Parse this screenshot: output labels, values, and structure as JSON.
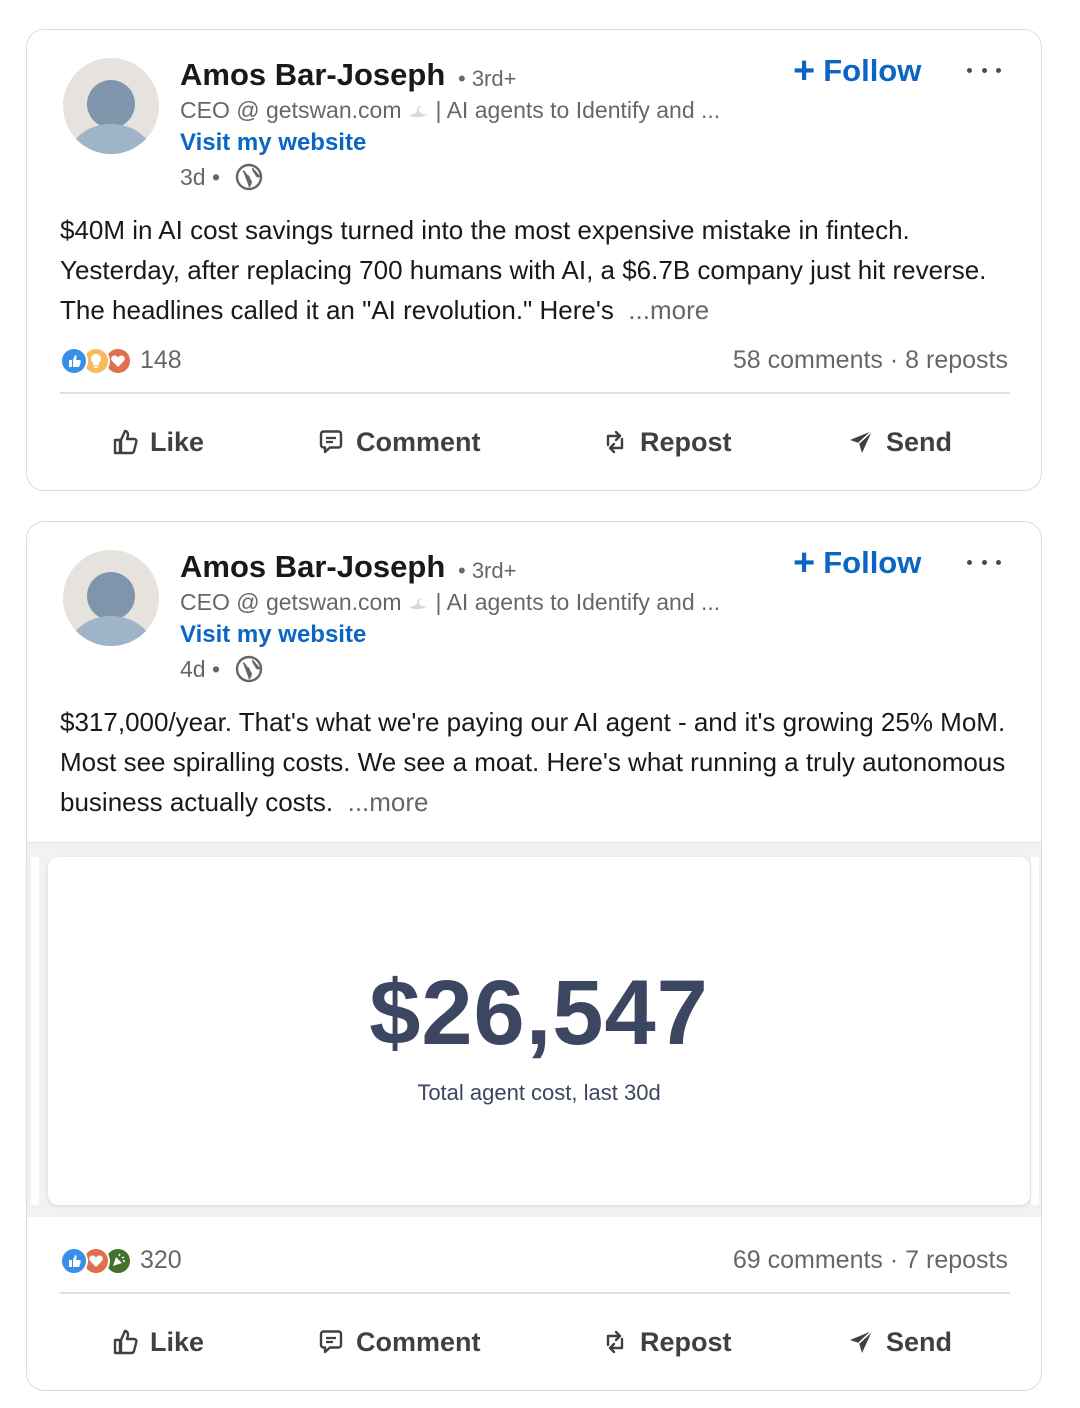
{
  "posts": [
    {
      "author": "Amos Bar-Joseph",
      "degree": "• 3rd+",
      "headline_pre": "CEO @ getswan.com",
      "headline_post": "| AI agents to Identify and ...",
      "website_link": "Visit my website",
      "time": "3d •",
      "follow_label": "Follow",
      "body": "$40M in AI cost savings turned into the most expensive mistake in fintech. Yesterday, after replacing 700 humans with AI, a $6.7B company just hit reverse. The headlines called it an \"AI revolution.\" Here's",
      "see_more": "...more",
      "reaction_icons": [
        "like-icon",
        "insightful-icon",
        "love-icon"
      ],
      "reaction_count": "148",
      "social_counts": "58 comments · 8 reposts",
      "actions": [
        "Like",
        "Comment",
        "Repost",
        "Send"
      ]
    },
    {
      "author": "Amos Bar-Joseph",
      "degree": "• 3rd+",
      "headline_pre": "CEO @ getswan.com",
      "headline_post": "| AI agents to Identify and ...",
      "website_link": "Visit my website",
      "time": "4d •",
      "follow_label": "Follow",
      "body": "$317,000/year. That's what we're paying our AI agent - and it's growing 25% MoM. Most see spiralling costs. We see a moat. Here's what running a truly autonomous business actually costs.",
      "see_more": "...more",
      "media": {
        "value": "$26,547",
        "label": "Total agent cost, last 30d"
      },
      "reaction_icons": [
        "like-icon",
        "love-icon",
        "celebrate-icon"
      ],
      "reaction_count": "320",
      "social_counts": "69 comments · 7 reposts",
      "actions": [
        "Like",
        "Comment",
        "Repost",
        "Send"
      ]
    }
  ],
  "colors": {
    "link_blue": "#0a66c2",
    "muted_text": "#666666",
    "media_text": "#3d4661"
  }
}
